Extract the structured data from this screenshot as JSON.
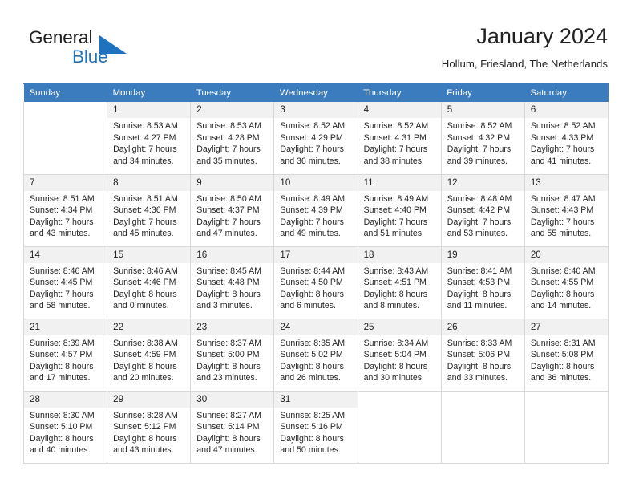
{
  "brand": {
    "name_top": "General",
    "name_bottom": "Blue",
    "flag_icon": "flag-triangle-icon",
    "accent_color": "#1f72bd"
  },
  "header": {
    "title": "January 2024",
    "subtitle": "Hollum, Friesland, The Netherlands"
  },
  "theme": {
    "header_row_bg": "#3a7cbe",
    "header_row_text": "#ffffff",
    "daynum_bg": "#f1f1f1",
    "cell_border": "#d8d8d8",
    "text": "#262626"
  },
  "weekday_headers": [
    "Sunday",
    "Monday",
    "Tuesday",
    "Wednesday",
    "Thursday",
    "Friday",
    "Saturday"
  ],
  "labels": {
    "sunrise_prefix": "Sunrise:",
    "sunset_prefix": "Sunset:",
    "daylight_prefix": "Daylight:"
  },
  "weeks": [
    [
      {
        "day": "",
        "sunrise": "",
        "sunset": "",
        "daylight_1": "",
        "daylight_2": ""
      },
      {
        "day": "1",
        "sunrise": "Sunrise: 8:53 AM",
        "sunset": "Sunset: 4:27 PM",
        "daylight_1": "Daylight: 7 hours",
        "daylight_2": "and 34 minutes."
      },
      {
        "day": "2",
        "sunrise": "Sunrise: 8:53 AM",
        "sunset": "Sunset: 4:28 PM",
        "daylight_1": "Daylight: 7 hours",
        "daylight_2": "and 35 minutes."
      },
      {
        "day": "3",
        "sunrise": "Sunrise: 8:52 AM",
        "sunset": "Sunset: 4:29 PM",
        "daylight_1": "Daylight: 7 hours",
        "daylight_2": "and 36 minutes."
      },
      {
        "day": "4",
        "sunrise": "Sunrise: 8:52 AM",
        "sunset": "Sunset: 4:31 PM",
        "daylight_1": "Daylight: 7 hours",
        "daylight_2": "and 38 minutes."
      },
      {
        "day": "5",
        "sunrise": "Sunrise: 8:52 AM",
        "sunset": "Sunset: 4:32 PM",
        "daylight_1": "Daylight: 7 hours",
        "daylight_2": "and 39 minutes."
      },
      {
        "day": "6",
        "sunrise": "Sunrise: 8:52 AM",
        "sunset": "Sunset: 4:33 PM",
        "daylight_1": "Daylight: 7 hours",
        "daylight_2": "and 41 minutes."
      }
    ],
    [
      {
        "day": "7",
        "sunrise": "Sunrise: 8:51 AM",
        "sunset": "Sunset: 4:34 PM",
        "daylight_1": "Daylight: 7 hours",
        "daylight_2": "and 43 minutes."
      },
      {
        "day": "8",
        "sunrise": "Sunrise: 8:51 AM",
        "sunset": "Sunset: 4:36 PM",
        "daylight_1": "Daylight: 7 hours",
        "daylight_2": "and 45 minutes."
      },
      {
        "day": "9",
        "sunrise": "Sunrise: 8:50 AM",
        "sunset": "Sunset: 4:37 PM",
        "daylight_1": "Daylight: 7 hours",
        "daylight_2": "and 47 minutes."
      },
      {
        "day": "10",
        "sunrise": "Sunrise: 8:49 AM",
        "sunset": "Sunset: 4:39 PM",
        "daylight_1": "Daylight: 7 hours",
        "daylight_2": "and 49 minutes."
      },
      {
        "day": "11",
        "sunrise": "Sunrise: 8:49 AM",
        "sunset": "Sunset: 4:40 PM",
        "daylight_1": "Daylight: 7 hours",
        "daylight_2": "and 51 minutes."
      },
      {
        "day": "12",
        "sunrise": "Sunrise: 8:48 AM",
        "sunset": "Sunset: 4:42 PM",
        "daylight_1": "Daylight: 7 hours",
        "daylight_2": "and 53 minutes."
      },
      {
        "day": "13",
        "sunrise": "Sunrise: 8:47 AM",
        "sunset": "Sunset: 4:43 PM",
        "daylight_1": "Daylight: 7 hours",
        "daylight_2": "and 55 minutes."
      }
    ],
    [
      {
        "day": "14",
        "sunrise": "Sunrise: 8:46 AM",
        "sunset": "Sunset: 4:45 PM",
        "daylight_1": "Daylight: 7 hours",
        "daylight_2": "and 58 minutes."
      },
      {
        "day": "15",
        "sunrise": "Sunrise: 8:46 AM",
        "sunset": "Sunset: 4:46 PM",
        "daylight_1": "Daylight: 8 hours",
        "daylight_2": "and 0 minutes."
      },
      {
        "day": "16",
        "sunrise": "Sunrise: 8:45 AM",
        "sunset": "Sunset: 4:48 PM",
        "daylight_1": "Daylight: 8 hours",
        "daylight_2": "and 3 minutes."
      },
      {
        "day": "17",
        "sunrise": "Sunrise: 8:44 AM",
        "sunset": "Sunset: 4:50 PM",
        "daylight_1": "Daylight: 8 hours",
        "daylight_2": "and 6 minutes."
      },
      {
        "day": "18",
        "sunrise": "Sunrise: 8:43 AM",
        "sunset": "Sunset: 4:51 PM",
        "daylight_1": "Daylight: 8 hours",
        "daylight_2": "and 8 minutes."
      },
      {
        "day": "19",
        "sunrise": "Sunrise: 8:41 AM",
        "sunset": "Sunset: 4:53 PM",
        "daylight_1": "Daylight: 8 hours",
        "daylight_2": "and 11 minutes."
      },
      {
        "day": "20",
        "sunrise": "Sunrise: 8:40 AM",
        "sunset": "Sunset: 4:55 PM",
        "daylight_1": "Daylight: 8 hours",
        "daylight_2": "and 14 minutes."
      }
    ],
    [
      {
        "day": "21",
        "sunrise": "Sunrise: 8:39 AM",
        "sunset": "Sunset: 4:57 PM",
        "daylight_1": "Daylight: 8 hours",
        "daylight_2": "and 17 minutes."
      },
      {
        "day": "22",
        "sunrise": "Sunrise: 8:38 AM",
        "sunset": "Sunset: 4:59 PM",
        "daylight_1": "Daylight: 8 hours",
        "daylight_2": "and 20 minutes."
      },
      {
        "day": "23",
        "sunrise": "Sunrise: 8:37 AM",
        "sunset": "Sunset: 5:00 PM",
        "daylight_1": "Daylight: 8 hours",
        "daylight_2": "and 23 minutes."
      },
      {
        "day": "24",
        "sunrise": "Sunrise: 8:35 AM",
        "sunset": "Sunset: 5:02 PM",
        "daylight_1": "Daylight: 8 hours",
        "daylight_2": "and 26 minutes."
      },
      {
        "day": "25",
        "sunrise": "Sunrise: 8:34 AM",
        "sunset": "Sunset: 5:04 PM",
        "daylight_1": "Daylight: 8 hours",
        "daylight_2": "and 30 minutes."
      },
      {
        "day": "26",
        "sunrise": "Sunrise: 8:33 AM",
        "sunset": "Sunset: 5:06 PM",
        "daylight_1": "Daylight: 8 hours",
        "daylight_2": "and 33 minutes."
      },
      {
        "day": "27",
        "sunrise": "Sunrise: 8:31 AM",
        "sunset": "Sunset: 5:08 PM",
        "daylight_1": "Daylight: 8 hours",
        "daylight_2": "and 36 minutes."
      }
    ],
    [
      {
        "day": "28",
        "sunrise": "Sunrise: 8:30 AM",
        "sunset": "Sunset: 5:10 PM",
        "daylight_1": "Daylight: 8 hours",
        "daylight_2": "and 40 minutes."
      },
      {
        "day": "29",
        "sunrise": "Sunrise: 8:28 AM",
        "sunset": "Sunset: 5:12 PM",
        "daylight_1": "Daylight: 8 hours",
        "daylight_2": "and 43 minutes."
      },
      {
        "day": "30",
        "sunrise": "Sunrise: 8:27 AM",
        "sunset": "Sunset: 5:14 PM",
        "daylight_1": "Daylight: 8 hours",
        "daylight_2": "and 47 minutes."
      },
      {
        "day": "31",
        "sunrise": "Sunrise: 8:25 AM",
        "sunset": "Sunset: 5:16 PM",
        "daylight_1": "Daylight: 8 hours",
        "daylight_2": "and 50 minutes."
      },
      {
        "day": "",
        "sunrise": "",
        "sunset": "",
        "daylight_1": "",
        "daylight_2": ""
      },
      {
        "day": "",
        "sunrise": "",
        "sunset": "",
        "daylight_1": "",
        "daylight_2": ""
      },
      {
        "day": "",
        "sunrise": "",
        "sunset": "",
        "daylight_1": "",
        "daylight_2": ""
      }
    ]
  ]
}
